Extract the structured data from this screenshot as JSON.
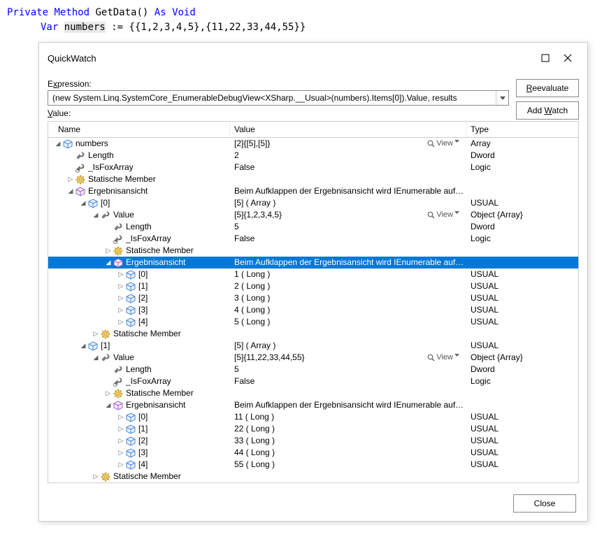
{
  "code": {
    "line1_kw1": "Private",
    "line1_kw2": "Method",
    "line1_name": "GetData()",
    "line1_kw3": "As",
    "line1_kw4": "Void",
    "line2_kw": "Var",
    "line2_var": "numbers",
    "line2_rest": " := {{1,2,3,4,5},{11,22,33,44,55}}"
  },
  "dialog": {
    "title": "QuickWatch",
    "expression_label_pre": "E",
    "expression_label_ul": "x",
    "expression_label_post": "pression:",
    "expression_value": "(new System.Linq.SystemCore_EnumerableDebugView<XSharp.__Usual>(numbers).Items[0]).Value, results",
    "value_label_pre": "",
    "value_label_ul": "V",
    "value_label_post": "alue:",
    "reevaluate_pre": "",
    "reevaluate_ul": "R",
    "reevaluate_post": "eevaluate",
    "addwatch_pre": "Add ",
    "addwatch_ul": "W",
    "addwatch_post": "atch",
    "close": "Close",
    "columns": {
      "name": "Name",
      "value": "Value",
      "type": "Type"
    },
    "view_label": "View"
  },
  "rows": [
    {
      "depth": 0,
      "exp": "open",
      "icon": "cube-b",
      "name": "numbers",
      "value": "[2]{[5],[5]}",
      "type": "Array",
      "view": true
    },
    {
      "depth": 1,
      "exp": "none",
      "icon": "wrench",
      "name": "Length",
      "value": "2",
      "type": "Dword"
    },
    {
      "depth": 1,
      "exp": "none",
      "icon": "wrench-key",
      "name": "_IsFoxArray",
      "value": "False",
      "type": "Logic"
    },
    {
      "depth": 1,
      "exp": "closed",
      "icon": "gear",
      "name": "Statische Member",
      "value": "",
      "type": ""
    },
    {
      "depth": 1,
      "exp": "open",
      "icon": "cube-p",
      "name": "Ergebnisansicht",
      "value": "Beim Aufklappen der Ergebnisansicht wird IEnumerable auf…",
      "type": ""
    },
    {
      "depth": 2,
      "exp": "open",
      "icon": "cube-b",
      "name": "[0]",
      "value": "[5] ( Array )",
      "type": "USUAL"
    },
    {
      "depth": 3,
      "exp": "open",
      "icon": "wrench",
      "name": "Value",
      "value": "[5]{1,2,3,4,5}",
      "type": "Object {Array}",
      "view": true
    },
    {
      "depth": 4,
      "exp": "none",
      "icon": "wrench",
      "name": "Length",
      "value": "5",
      "type": "Dword"
    },
    {
      "depth": 4,
      "exp": "none",
      "icon": "wrench-key",
      "name": "_IsFoxArray",
      "value": "False",
      "type": "Logic"
    },
    {
      "depth": 4,
      "exp": "closed",
      "icon": "gear",
      "name": "Statische Member",
      "value": "",
      "type": ""
    },
    {
      "depth": 4,
      "exp": "open",
      "icon": "cube-p",
      "name": "Ergebnisansicht",
      "value": "Beim Aufklappen der Ergebnisansicht wird IEnumerable auf…",
      "type": "",
      "selected": true
    },
    {
      "depth": 5,
      "exp": "closed",
      "icon": "cube-b",
      "name": "[0]",
      "value": "1 ( Long )",
      "type": "USUAL"
    },
    {
      "depth": 5,
      "exp": "closed",
      "icon": "cube-b",
      "name": "[1]",
      "value": "2 ( Long )",
      "type": "USUAL"
    },
    {
      "depth": 5,
      "exp": "closed",
      "icon": "cube-b",
      "name": "[2]",
      "value": "3 ( Long )",
      "type": "USUAL"
    },
    {
      "depth": 5,
      "exp": "closed",
      "icon": "cube-b",
      "name": "[3]",
      "value": "4 ( Long )",
      "type": "USUAL"
    },
    {
      "depth": 5,
      "exp": "closed",
      "icon": "cube-b",
      "name": "[4]",
      "value": "5 ( Long )",
      "type": "USUAL"
    },
    {
      "depth": 3,
      "exp": "closed",
      "icon": "gear",
      "name": "Statische Member",
      "value": "",
      "type": ""
    },
    {
      "depth": 2,
      "exp": "open",
      "icon": "cube-b",
      "name": "[1]",
      "value": "[5] ( Array )",
      "type": "USUAL"
    },
    {
      "depth": 3,
      "exp": "open",
      "icon": "wrench",
      "name": "Value",
      "value": "[5]{11,22,33,44,55}",
      "type": "Object {Array}",
      "view": true
    },
    {
      "depth": 4,
      "exp": "none",
      "icon": "wrench",
      "name": "Length",
      "value": "5",
      "type": "Dword"
    },
    {
      "depth": 4,
      "exp": "none",
      "icon": "wrench-key",
      "name": "_IsFoxArray",
      "value": "False",
      "type": "Logic"
    },
    {
      "depth": 4,
      "exp": "closed",
      "icon": "gear",
      "name": "Statische Member",
      "value": "",
      "type": ""
    },
    {
      "depth": 4,
      "exp": "open",
      "icon": "cube-p",
      "name": "Ergebnisansicht",
      "value": "Beim Aufklappen der Ergebnisansicht wird IEnumerable auf…",
      "type": ""
    },
    {
      "depth": 5,
      "exp": "closed",
      "icon": "cube-b",
      "name": "[0]",
      "value": "11 ( Long )",
      "type": "USUAL"
    },
    {
      "depth": 5,
      "exp": "closed",
      "icon": "cube-b",
      "name": "[1]",
      "value": "22 ( Long )",
      "type": "USUAL"
    },
    {
      "depth": 5,
      "exp": "closed",
      "icon": "cube-b",
      "name": "[2]",
      "value": "33 ( Long )",
      "type": "USUAL"
    },
    {
      "depth": 5,
      "exp": "closed",
      "icon": "cube-b",
      "name": "[3]",
      "value": "44 ( Long )",
      "type": "USUAL"
    },
    {
      "depth": 5,
      "exp": "closed",
      "icon": "cube-b",
      "name": "[4]",
      "value": "55 ( Long )",
      "type": "USUAL"
    },
    {
      "depth": 3,
      "exp": "closed",
      "icon": "gear",
      "name": "Statische Member",
      "value": "",
      "type": ""
    }
  ]
}
